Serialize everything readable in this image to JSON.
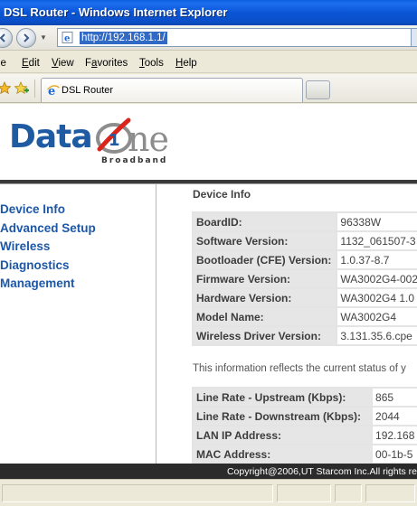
{
  "window": {
    "title": "DSL Router - Windows Internet Explorer"
  },
  "address_bar": {
    "url": "http://192.168.1.1/"
  },
  "menu": {
    "items": [
      {
        "label": "File",
        "underline": "F"
      },
      {
        "label": "Edit",
        "underline": "E"
      },
      {
        "label": "View",
        "underline": "V"
      },
      {
        "label": "Favorites",
        "underline": "a"
      },
      {
        "label": "Tools",
        "underline": "T"
      },
      {
        "label": "Help",
        "underline": "H"
      }
    ]
  },
  "tabs": [
    {
      "label": "DSL Router"
    }
  ],
  "logo": {
    "brand_left": "Data",
    "brand_right": "ne",
    "tagline": "Broadband",
    "colors": {
      "primary": "#1f5ba3",
      "accent": "#d9261c",
      "gray": "#8d8d8d"
    }
  },
  "sidebar": {
    "items": [
      {
        "label": "Device Info"
      },
      {
        "label": "Advanced Setup"
      },
      {
        "label": "Wireless"
      },
      {
        "label": "Diagnostics"
      },
      {
        "label": "Management"
      }
    ]
  },
  "device_info": {
    "title": "Device Info",
    "rows": [
      {
        "label": "BoardID:",
        "value": "96338W"
      },
      {
        "label": "Software Version:",
        "value": "1132_061507-3"
      },
      {
        "label": "Bootloader (CFE) Version:",
        "value": "1.0.37-8.7"
      },
      {
        "label": "Firmware Version:",
        "value": "WA3002G4-002"
      },
      {
        "label": "Hardware Version:",
        "value": "WA3002G4 1.0"
      },
      {
        "label": "Model Name:",
        "value": "WA3002G4"
      },
      {
        "label": "Wireless Driver Version:",
        "value": "3.131.35.6.cpe"
      }
    ],
    "note": "This information reflects the current status of y",
    "status_rows": [
      {
        "label": "Line Rate - Upstream (Kbps):",
        "value": "865"
      },
      {
        "label": "Line Rate - Downstream (Kbps):",
        "value": "2044"
      },
      {
        "label": "LAN IP Address:",
        "value": "192.168"
      },
      {
        "label": "MAC Address:",
        "value": "00-1b-5"
      }
    ]
  },
  "footer": {
    "copyright": "Copyright@2006,UT Starcom Inc.All rights re"
  }
}
